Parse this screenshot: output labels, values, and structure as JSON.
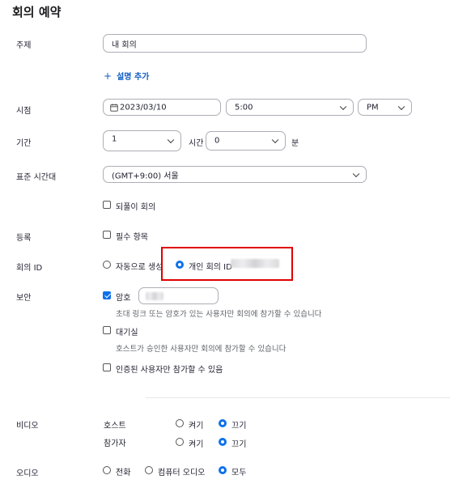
{
  "page": {
    "title": "회의 예약"
  },
  "topic": {
    "label": "주제",
    "value": "내 회의",
    "add_description": "설명 추가"
  },
  "when": {
    "label": "시점",
    "date": "2023/03/10",
    "time": "5:00",
    "ampm": "PM"
  },
  "duration": {
    "label": "기간",
    "hours": "1",
    "hours_unit": "시간",
    "minutes": "0",
    "minutes_unit": "분"
  },
  "timezone": {
    "label": "표준 시간대",
    "value": "(GMT+9:00) 서울"
  },
  "recurring": {
    "label": "되풀이 회의",
    "checked": false
  },
  "registration": {
    "label": "등록",
    "option": "필수 항목",
    "checked": false
  },
  "meeting_id": {
    "label": "회의 ID",
    "auto": "자동으로 생성",
    "personal": "개인 회의 ID",
    "selected": "personal"
  },
  "security": {
    "label": "보안",
    "passcode_label": "암호",
    "passcode_checked": true,
    "passcode_hint": "초대 링크 또는 암호가 있는 사용자만 회의에 참가할 수 있습니다",
    "waiting_room": "대기실",
    "waiting_room_checked": false,
    "waiting_room_hint": "호스트가 승인한 사용자만 회의에 참가할 수 있습니다",
    "auth_only": "인증된 사용자만 참가할 수 있음",
    "auth_only_checked": false
  },
  "video": {
    "label": "비디오",
    "host_label": "호스트",
    "participant_label": "참가자",
    "on": "켜기",
    "off": "끄기",
    "host_state": "off",
    "participant_state": "off"
  },
  "audio": {
    "label": "오디오",
    "telephone": "전화",
    "computer": "컴퓨터 오디오",
    "both": "모두",
    "selected": "both"
  },
  "colors": {
    "accent": "#0e71eb",
    "highlight": "#e00000"
  }
}
